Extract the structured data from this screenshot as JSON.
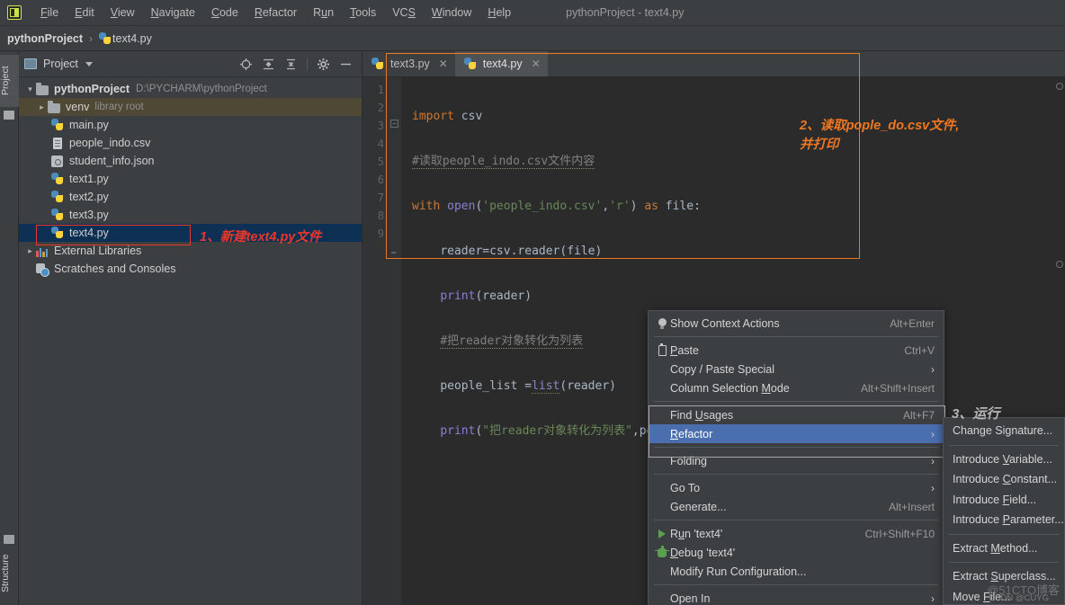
{
  "window": {
    "title": "pythonProject - text4.py",
    "logo_icon": "pycharm-logo-icon"
  },
  "menubar": {
    "items": [
      {
        "label": "File",
        "mnemonic": "F"
      },
      {
        "label": "Edit",
        "mnemonic": "E"
      },
      {
        "label": "View",
        "mnemonic": "V"
      },
      {
        "label": "Navigate",
        "mnemonic": "N"
      },
      {
        "label": "Code",
        "mnemonic": "C"
      },
      {
        "label": "Refactor",
        "mnemonic": "R"
      },
      {
        "label": "Run",
        "mnemonic": "u"
      },
      {
        "label": "Tools",
        "mnemonic": "T"
      },
      {
        "label": "VCS",
        "mnemonic": "S"
      },
      {
        "label": "Window",
        "mnemonic": "W"
      },
      {
        "label": "Help",
        "mnemonic": "H"
      }
    ]
  },
  "breadcrumb": {
    "project": "pythonProject",
    "separator": "›",
    "file": "text4.py"
  },
  "toolstrip": {
    "top_tab": "Project",
    "bottom_tab": "Structure"
  },
  "project_panel": {
    "title": "Project",
    "tools": [
      "locate-icon",
      "expand-all-icon",
      "collapse-all-icon",
      "settings-gear-icon",
      "hide-panel-icon"
    ],
    "tree": [
      {
        "label": "pythonProject",
        "path": "D:\\PYCHARM\\pythonProject",
        "icon": "folder-icon",
        "expanded": true,
        "depth": 0,
        "bold": true
      },
      {
        "label": "venv",
        "note": "library root",
        "icon": "folder-icon",
        "expanded": false,
        "depth": 1,
        "highlight": "venv"
      },
      {
        "label": "main.py",
        "icon": "python-file-icon",
        "depth": 2
      },
      {
        "label": "people_indo.csv",
        "icon": "csv-file-icon",
        "depth": 2
      },
      {
        "label": "student_info.json",
        "icon": "json-file-icon",
        "depth": 2
      },
      {
        "label": "text1.py",
        "icon": "python-file-icon",
        "depth": 2
      },
      {
        "label": "text2.py",
        "icon": "python-file-icon",
        "depth": 2
      },
      {
        "label": "text3.py",
        "icon": "python-file-icon",
        "depth": 2
      },
      {
        "label": "text4.py",
        "icon": "python-file-icon",
        "depth": 2,
        "selected": true
      },
      {
        "label": "External Libraries",
        "icon": "libraries-icon",
        "expanded": false,
        "depth": 0
      },
      {
        "label": "Scratches and Consoles",
        "icon": "scratches-icon",
        "depth": 0
      }
    ]
  },
  "annotations": {
    "step1": "1、新建text4.py文件",
    "step2_line1": "2、读取pople_do.csv文件,",
    "step2_line2": "并打印",
    "step3": "3、运行",
    "red_color": "#e8382b",
    "orange_color": "#ee7722"
  },
  "editor": {
    "tabs": [
      {
        "label": "text3.py",
        "icon": "python-file-icon",
        "active": false,
        "close_icon": "close-icon"
      },
      {
        "label": "text4.py",
        "icon": "python-file-icon",
        "active": true,
        "close_icon": "close-icon"
      }
    ],
    "line_numbers": [
      "1",
      "2",
      "3",
      "4",
      "5",
      "6",
      "7",
      "8",
      "9"
    ],
    "lines": [
      {
        "n": 1,
        "text": "import csv"
      },
      {
        "n": 2,
        "text": "#读取people_indo.csv文件内容"
      },
      {
        "n": 3,
        "text": "with open('people_indo.csv','r') as file:"
      },
      {
        "n": 4,
        "text": "    reader=csv.reader(file)"
      },
      {
        "n": 5,
        "text": "    print(reader)"
      },
      {
        "n": 6,
        "text": "    #把reader对象转化为列表"
      },
      {
        "n": 7,
        "text": "    people_list =list(reader)"
      },
      {
        "n": 8,
        "text": "    print(\"把reader对象转化为列表\",people_list)"
      },
      {
        "n": 9,
        "text": ""
      }
    ]
  },
  "context_menu": {
    "items": [
      {
        "label": "Show Context Actions",
        "accel": "Alt+Enter",
        "icon": "lightbulb-icon",
        "mnemonic": ""
      },
      {
        "sep": true
      },
      {
        "label": "Paste",
        "accel": "Ctrl+V",
        "icon": "clipboard-icon",
        "mnemonic": "P"
      },
      {
        "label": "Copy / Paste Special",
        "accel": "",
        "submenu": true
      },
      {
        "label": "Column Selection Mode",
        "accel": "Alt+Shift+Insert",
        "mnemonic": "M"
      },
      {
        "sep": true
      },
      {
        "label": "Find Usages",
        "accel": "Alt+F7",
        "mnemonic": "U"
      },
      {
        "label": "Refactor",
        "accel": "",
        "submenu": true,
        "highlighted": true,
        "mnemonic": "R"
      },
      {
        "sep": true
      },
      {
        "label": "Folding",
        "accel": "",
        "submenu": true
      },
      {
        "sep": true
      },
      {
        "label": "Go To",
        "accel": "",
        "submenu": true
      },
      {
        "label": "Generate...",
        "accel": "Alt+Insert"
      },
      {
        "sep": true
      },
      {
        "label": "Run 'text4'",
        "accel": "Ctrl+Shift+F10",
        "icon": "run-play-icon",
        "mnemonic": "u"
      },
      {
        "label": "Debug 'text4'",
        "accel": "",
        "icon": "debug-bug-icon",
        "mnemonic": "D"
      },
      {
        "label": "Modify Run Configuration...",
        "accel": ""
      },
      {
        "sep": true
      },
      {
        "label": "Open In",
        "accel": "",
        "submenu": true
      }
    ]
  },
  "submenu": {
    "items": [
      {
        "label": "Change Signature...",
        "mnemonic": "g"
      },
      {
        "sep": true
      },
      {
        "label": "Introduce Variable...",
        "mnemonic": "V"
      },
      {
        "label": "Introduce Constant...",
        "mnemonic": "C"
      },
      {
        "label": "Introduce Field...",
        "mnemonic": "F"
      },
      {
        "label": "Introduce Parameter...",
        "mnemonic": "P"
      },
      {
        "sep": true
      },
      {
        "label": "Extract Method...",
        "mnemonic": "M"
      },
      {
        "sep": true
      },
      {
        "label": "Extract Superclass...",
        "mnemonic": "S"
      },
      {
        "label": "Move File...",
        "mnemonic": "F"
      }
    ]
  },
  "watermark": {
    "primary": "@51CTO博客",
    "secondary": "CSDN @CUYG"
  }
}
